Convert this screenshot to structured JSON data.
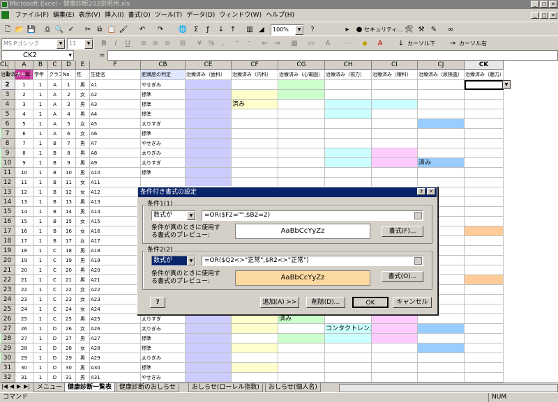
{
  "window": {
    "title": "Microsoft Excel - 健康診断202説明用.xls"
  },
  "menu": [
    "ファイル(F)",
    "編集(E)",
    "表示(V)",
    "挿入(I)",
    "書式(O)",
    "ツール(T)",
    "データ(D)",
    "ウィンドウ(W)",
    "ヘルプ(H)"
  ],
  "toolbar": {
    "zoom": "100%",
    "security_label": "セキュリティ...",
    "font_name": "MS Pゴシック",
    "font_size": "11",
    "cursor_down": "カーソル下",
    "cursor_right": "カーソル右"
  },
  "formula_bar": {
    "name_box": "CK2",
    "fx": "="
  },
  "columns": [
    {
      "letter": "A",
      "header": "番号"
    },
    {
      "letter": "B",
      "header": "学年"
    },
    {
      "letter": "C",
      "header": "クラス"
    },
    {
      "letter": "D",
      "header": "No"
    },
    {
      "letter": "E",
      "header": "性"
    },
    {
      "letter": "F",
      "header": "生徒名"
    },
    {
      "letter": "CB",
      "header": "肥満度の判定"
    },
    {
      "letter": "CE",
      "header": "治療済み（歯科）"
    },
    {
      "letter": "CF",
      "header": "治療済み（内科）"
    },
    {
      "letter": "CG",
      "header": "治療済み（心電図）"
    },
    {
      "letter": "CH",
      "header": "治療済み（視力）"
    },
    {
      "letter": "CI",
      "header": "治療済み（眼科）"
    },
    {
      "letter": "CJ",
      "header": "治療済み（尿検査）"
    },
    {
      "letter": "CK",
      "header": "治療済み（聴力）"
    },
    {
      "letter": "CL",
      "header": "治療済み（耳"
    }
  ],
  "rows": [
    {
      "n": "2",
      "a": "1",
      "b": "1",
      "c": "A",
      "d": "1",
      "e": "男",
      "f": "A1",
      "cb": "やせぎみ"
    },
    {
      "n": "3",
      "a": "2",
      "b": "1",
      "c": "A",
      "d": "2",
      "e": "女",
      "f": "A2",
      "cb": "標準"
    },
    {
      "n": "4",
      "a": "3",
      "b": "1",
      "c": "A",
      "d": "3",
      "e": "男",
      "f": "A3",
      "cb": "標準"
    },
    {
      "n": "5",
      "a": "4",
      "b": "1",
      "c": "A",
      "d": "4",
      "e": "男",
      "f": "A4",
      "cb": "標準"
    },
    {
      "n": "6",
      "a": "5",
      "b": "1",
      "c": "A",
      "d": "5",
      "e": "女",
      "f": "A5",
      "cb": "太りすぎ"
    },
    {
      "n": "7",
      "a": "6",
      "b": "1",
      "c": "A",
      "d": "6",
      "e": "女",
      "f": "A6",
      "cb": "標準"
    },
    {
      "n": "8",
      "a": "7",
      "b": "1",
      "c": "B",
      "d": "7",
      "e": "男",
      "f": "A7",
      "cb": "やせぎみ"
    },
    {
      "n": "9",
      "a": "8",
      "b": "1",
      "c": "B",
      "d": "8",
      "e": "男",
      "f": "A8",
      "cb": "太りぎみ"
    },
    {
      "n": "10",
      "a": "9",
      "b": "1",
      "c": "B",
      "d": "9",
      "e": "男",
      "f": "A9",
      "cb": "太りすぎ"
    },
    {
      "n": "11",
      "a": "10",
      "b": "1",
      "c": "B",
      "d": "10",
      "e": "男",
      "f": "A10",
      "cb": "標準"
    },
    {
      "n": "12",
      "a": "11",
      "b": "1",
      "c": "B",
      "d": "11",
      "e": "女",
      "f": "A11",
      "cb": ""
    },
    {
      "n": "13",
      "a": "12",
      "b": "1",
      "c": "B",
      "d": "12",
      "e": "女",
      "f": "A12",
      "cb": ""
    },
    {
      "n": "14",
      "a": "13",
      "b": "1",
      "c": "B",
      "d": "13",
      "e": "男",
      "f": "A13",
      "cb": ""
    },
    {
      "n": "15",
      "a": "14",
      "b": "1",
      "c": "B",
      "d": "14",
      "e": "男",
      "f": "A14",
      "cb": ""
    },
    {
      "n": "16",
      "a": "15",
      "b": "1",
      "c": "B",
      "d": "15",
      "e": "女",
      "f": "A15",
      "cb": ""
    },
    {
      "n": "17",
      "a": "16",
      "b": "1",
      "c": "B",
      "d": "16",
      "e": "女",
      "f": "A16",
      "cb": ""
    },
    {
      "n": "18",
      "a": "17",
      "b": "1",
      "c": "B",
      "d": "17",
      "e": "女",
      "f": "A17",
      "cb": ""
    },
    {
      "n": "19",
      "a": "18",
      "b": "1",
      "c": "C",
      "d": "18",
      "e": "男",
      "f": "A18",
      "cb": ""
    },
    {
      "n": "20",
      "a": "19",
      "b": "1",
      "c": "C",
      "d": "19",
      "e": "男",
      "f": "A19",
      "cb": ""
    },
    {
      "n": "21",
      "a": "20",
      "b": "1",
      "c": "C",
      "d": "20",
      "e": "男",
      "f": "A20",
      "cb": ""
    },
    {
      "n": "22",
      "a": "21",
      "b": "1",
      "c": "C",
      "d": "21",
      "e": "男",
      "f": "A21",
      "cb": ""
    },
    {
      "n": "23",
      "a": "22",
      "b": "1",
      "c": "C",
      "d": "22",
      "e": "女",
      "f": "A22",
      "cb": ""
    },
    {
      "n": "24",
      "a": "23",
      "b": "1",
      "c": "C",
      "d": "23",
      "e": "女",
      "f": "A23",
      "cb": ""
    },
    {
      "n": "25",
      "a": "24",
      "b": "1",
      "c": "C",
      "d": "24",
      "e": "女",
      "f": "A24",
      "cb": ""
    },
    {
      "n": "26",
      "a": "25",
      "b": "1",
      "c": "C",
      "d": "25",
      "e": "男",
      "f": "A25",
      "cb": "太りすぎ"
    },
    {
      "n": "27",
      "a": "26",
      "b": "1",
      "c": "D",
      "d": "26",
      "e": "女",
      "f": "A26",
      "cb": "太りぎみ"
    },
    {
      "n": "28",
      "a": "27",
      "b": "1",
      "c": "D",
      "d": "27",
      "e": "男",
      "f": "A27",
      "cb": "標準"
    },
    {
      "n": "29",
      "a": "28",
      "b": "1",
      "c": "D",
      "d": "28",
      "e": "女",
      "f": "A28",
      "cb": "標準"
    },
    {
      "n": "30",
      "a": "29",
      "b": "1",
      "c": "D",
      "d": "29",
      "e": "男",
      "f": "A29",
      "cb": "太りぎみ"
    },
    {
      "n": "31",
      "a": "30",
      "b": "1",
      "c": "D",
      "d": "30",
      "e": "男",
      "f": "A30",
      "cb": "標準"
    },
    {
      "n": "32",
      "a": "31",
      "b": "1",
      "c": "D",
      "d": "31",
      "e": "男",
      "f": "A31",
      "cb": "やせぎみ"
    }
  ],
  "cell_texts": {
    "cf4": "済み",
    "cj10": "済み",
    "cg26": "済み",
    "ch27": "コンタクトレンズ"
  },
  "colors": {
    "lavender": "#ccccff",
    "yellow": "#ffffcc",
    "cyan": "#ccffff",
    "pink": "#ffccff",
    "blue": "#99ccff",
    "green": "#ccffcc",
    "tan": "#ffcc99",
    "title_blue": "#0a246a"
  },
  "dialog": {
    "title": "条件付き書式の設定",
    "help_glyph": "?",
    "close_glyph": "✕",
    "cond1_label": "条件1(1)",
    "cond1_type": "数式が",
    "cond1_formula": "=OR($F2=\"\",$B2=2)",
    "cond1_preview_label": "条件が真のときに使用する書式のプレビュー:",
    "cond1_preview_text": "AaBbCcYyZz",
    "cond1_format_btn": "書式(F)...",
    "cond2_label": "条件2(2)",
    "cond2_type": "数式が",
    "cond2_formula": "=OR($Q2<>\"正常\",$R2<>\"正常\")",
    "cond2_preview_label": "条件が真のときに使用する書式のプレビュー:",
    "cond2_preview_text": "AaBbCcYyZz",
    "cond2_format_btn": "書式(O)...",
    "help_btn": "?",
    "add_btn": "追加(A) >>",
    "delete_btn": "削除(D)...",
    "ok_btn": "OK",
    "cancel_btn": "キャンセル"
  },
  "sheet_tabs": [
    "メニュー",
    "健康診断一覧表",
    "健康診断のおしらせ",
    "おしらせ(ローレル指数)",
    "おしらせ(個人名)"
  ],
  "status": {
    "mode": "コマンド",
    "num": "NUM"
  }
}
